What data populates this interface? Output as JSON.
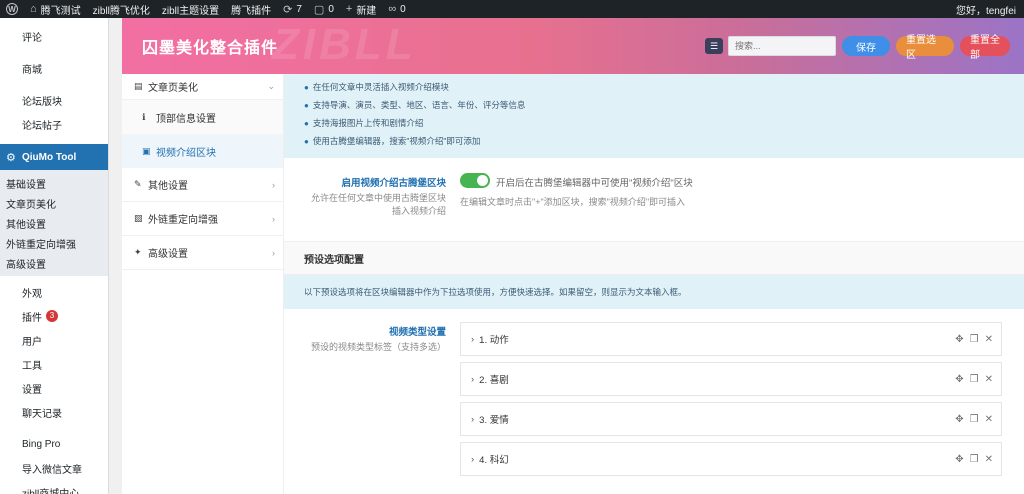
{
  "adminbar": {
    "site": "腾飞测试",
    "items": [
      "zibll腾飞优化",
      "zibll主题设置",
      "腾飞插件"
    ],
    "updates": "7",
    "comments": "0",
    "new": "新建",
    "links": "0",
    "greeting": "您好，tengfei"
  },
  "menu": {
    "top": [
      "评论",
      "商城",
      "论坛版块",
      "论坛帖子"
    ],
    "current": "QiuMo Tool",
    "sub": [
      "基础设置",
      "文章页美化",
      "其他设置",
      "外链重定向增强",
      "高级设置"
    ],
    "bottom": [
      {
        "label": "外观"
      },
      {
        "label": "插件",
        "badge": "3"
      },
      {
        "label": "用户"
      },
      {
        "label": "工具"
      },
      {
        "label": "设置"
      },
      {
        "label": "聊天记录"
      },
      {
        "label": "Bing Pro"
      },
      {
        "label": "导入微信文章"
      },
      {
        "label": "zibll商城中心"
      }
    ]
  },
  "header": {
    "title": "囚墨美化整合插件",
    "watermark": "ZIBLL",
    "search_placeholder": "搜索...",
    "save": "保存",
    "reset_section": "重置选区",
    "reset_all": "重置全部"
  },
  "tabs": {
    "article": "文章页美化",
    "top_info": "顶部信息设置",
    "video_block": "视频介绍区块",
    "other": "其他设置",
    "redirect": "外链重定向增强",
    "advanced": "高级设置"
  },
  "notice": [
    "在任何文章中灵活插入视频介绍模块",
    "支持导演、演员、类型、地区、语言、年份、评分等信息",
    "支持海报图片上传和剧情介绍",
    "使用古腾堡编辑器，搜索\"视频介绍\"即可添加"
  ],
  "enable_field": {
    "title": "启用视频介绍古腾堡区块",
    "desc": "允许在任何文章中使用古腾堡区块插入视频介绍",
    "toggle_text": "开启后在古腾堡编辑器中可使用\"视频介绍\"区块",
    "hint": "在编辑文章时点击\"+\"添加区块，搜索\"视频介绍\"即可插入"
  },
  "preset": {
    "section_title": "预设选项配置",
    "info": "以下预设选项将在区块编辑器中作为下拉选项使用，方便快速选择。如果留空，则显示为文本输入框。",
    "field_title": "视频类型设置",
    "field_desc": "预设的视频类型标签（支持多选）",
    "items": [
      "1. 动作",
      "2. 喜剧",
      "3. 爱情",
      "4. 科幻"
    ]
  }
}
